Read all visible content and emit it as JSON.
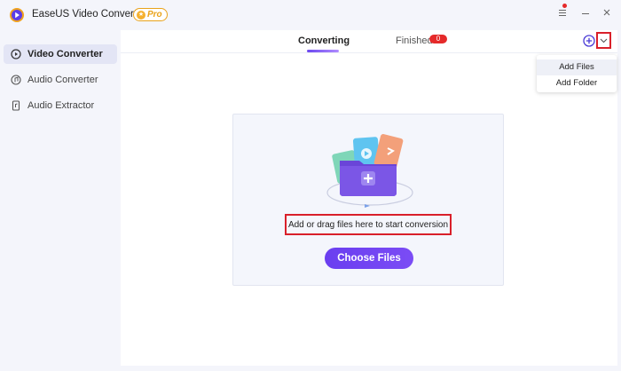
{
  "app": {
    "title": "EaseUS Video Converter",
    "badge": "Pro"
  },
  "window": {
    "menu_icon": "hamburger-icon",
    "min_icon": "minimize-icon",
    "close_icon": "close-icon"
  },
  "sidebar": {
    "items": [
      {
        "label": "Video Converter",
        "icon": "video-converter-icon",
        "active": true
      },
      {
        "label": "Audio Converter",
        "icon": "audio-converter-icon",
        "active": false
      },
      {
        "label": "Audio Extractor",
        "icon": "audio-extractor-icon",
        "active": false
      }
    ]
  },
  "tabs": {
    "converting": "Converting",
    "finished": "Finished",
    "finished_count": "0"
  },
  "dropdown": {
    "items": [
      "Add Files",
      "Add Folder"
    ]
  },
  "dropzone": {
    "hint": "Add or drag files here to start conversion",
    "button": "Choose Files"
  },
  "colors": {
    "accent": "#6a3ef0",
    "highlight": "#d9202a",
    "badge": "#e52a2a",
    "pro": "#e9a21a"
  }
}
